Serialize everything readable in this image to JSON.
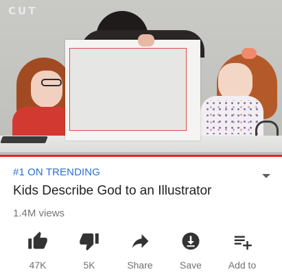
{
  "player": {
    "watermark": "CUT",
    "progress_fraction": 1.0,
    "colors": {
      "progress": "#ee1c1c"
    }
  },
  "info": {
    "trending": "#1 ON TRENDING",
    "title": "Kids Describe God to an Illustrator",
    "views": "1.4M views"
  },
  "actions": [
    {
      "icon": "thumbs-up-icon",
      "label": "47K"
    },
    {
      "icon": "thumbs-down-icon",
      "label": "5K"
    },
    {
      "icon": "share-icon",
      "label": "Share"
    },
    {
      "icon": "download-icon",
      "label": "Save"
    },
    {
      "icon": "add-to-playlist-icon",
      "label": "Add to"
    }
  ],
  "colors": {
    "accent": "#2b6fd1",
    "icon": "#333333",
    "secondary_text": "#757575"
  }
}
